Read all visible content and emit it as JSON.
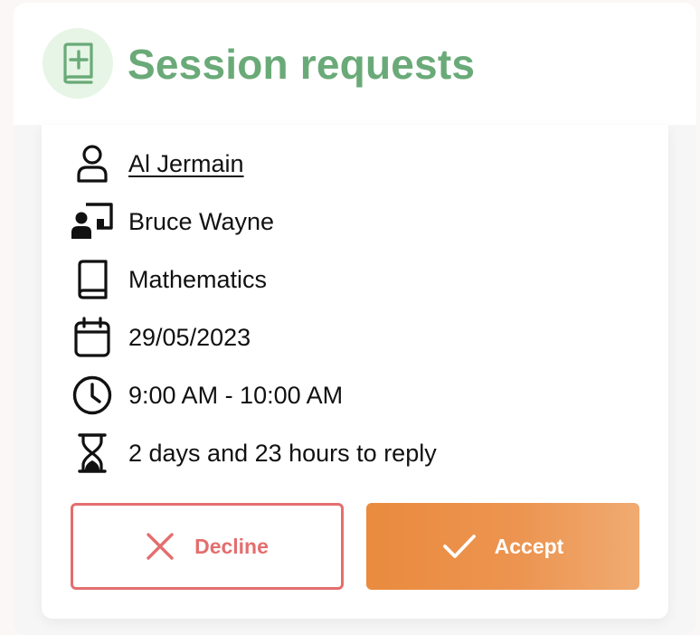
{
  "header": {
    "title": "Session requests",
    "icon": "book-plus-icon",
    "accent_color": "#6aaa78"
  },
  "session": {
    "rows": [
      {
        "icon": "user-icon",
        "text": "Al Jermain",
        "is_link": true
      },
      {
        "icon": "teacher-icon",
        "text": "Bruce Wayne"
      },
      {
        "icon": "book-icon",
        "text": "Mathematics"
      },
      {
        "icon": "calendar-icon",
        "text": "29/05/2023"
      },
      {
        "icon": "clock-icon",
        "text": "9:00 AM - 10:00 AM"
      },
      {
        "icon": "hourglass-icon",
        "text": "2 days and 23 hours to reply"
      }
    ]
  },
  "actions": {
    "decline_label": "Decline",
    "decline_color": "#e46e6e",
    "accept_label": "Accept",
    "accept_color": "#ea8b3e"
  }
}
